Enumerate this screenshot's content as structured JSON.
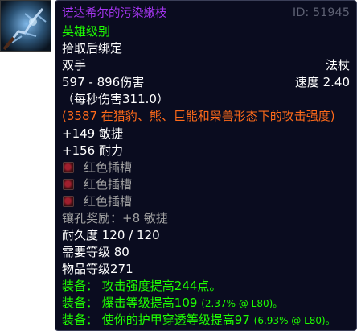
{
  "item": {
    "name": "诺达希尔的污染嫩枝",
    "id": "ID: 51945",
    "quality": "英雄级别",
    "binding": "拾取后绑定",
    "slot": "双手",
    "type": "法杖",
    "damage": "597 - 896伤害",
    "speed": "速度 2.40",
    "dps": "（每秒伤害311.0）",
    "feral_ap": "(3587 在猎豹、熊、巨能和枭兽形态下的攻击强度)",
    "stats": [
      "+149 敏捷",
      "+156 耐力"
    ],
    "sockets": [
      "红色插槽",
      "红色插槽",
      "红色插槽"
    ],
    "socket_bonus": "镶孔奖励：+8 敏捷",
    "durability": "耐久度 120 / 120",
    "required_level": "需要等级 80",
    "item_level": "物品等级271",
    "equip": [
      {
        "prefix": "装备：",
        "text": "攻击强度提高244点。",
        "note": ""
      },
      {
        "prefix": "装备：",
        "text": "爆击等级提高109",
        "note": "(2.37% @ L80)。"
      },
      {
        "prefix": "装备：",
        "text": "使你的护甲穿透等级提高97",
        "note": "(6.93% @ L80)。"
      }
    ]
  },
  "colors": {
    "epic": "#a335ee",
    "uncommon": "#1eff00",
    "feral": "#ff6a1a",
    "background": "#0a0c1f",
    "id_grey": "#5d6072"
  },
  "icons": {
    "item_icon": "staff-icon",
    "socket_icon": "red-socket-icon"
  }
}
